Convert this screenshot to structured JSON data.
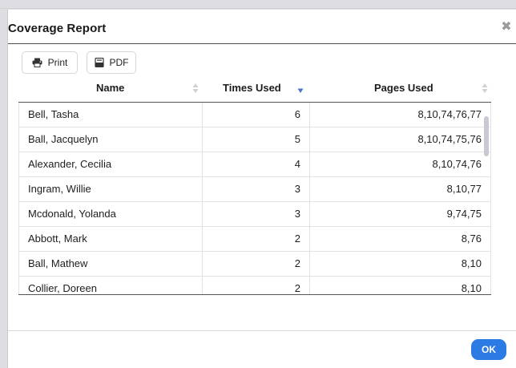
{
  "dialog": {
    "title": "Coverage Report",
    "close_label": "✖"
  },
  "toolbar": {
    "print_label": "Print",
    "pdf_label": "PDF"
  },
  "table": {
    "columns": [
      {
        "label": "Name",
        "sort": "none"
      },
      {
        "label": "Times Used",
        "sort": "descending"
      },
      {
        "label": "Pages Used",
        "sort": "none"
      }
    ],
    "rows": [
      {
        "name": "Bell, Tasha",
        "times": "6",
        "pages": "8,10,74,76,77"
      },
      {
        "name": "Ball, Jacquelyn",
        "times": "5",
        "pages": "8,10,74,75,76"
      },
      {
        "name": "Alexander, Cecilia",
        "times": "4",
        "pages": "8,10,74,76"
      },
      {
        "name": "Ingram, Willie",
        "times": "3",
        "pages": "8,10,77"
      },
      {
        "name": "Mcdonald, Yolanda",
        "times": "3",
        "pages": "9,74,75"
      },
      {
        "name": "Abbott, Mark",
        "times": "2",
        "pages": "8,76"
      },
      {
        "name": "Ball, Mathew",
        "times": "2",
        "pages": "8,10"
      },
      {
        "name": "Collier, Doreen",
        "times": "2",
        "pages": "8,10"
      }
    ]
  },
  "footer": {
    "ok_label": "OK"
  },
  "colors": {
    "accent": "#2c7be5",
    "sort_active": "#4a74c9",
    "sort_inactive": "#d0d0d6"
  },
  "icons": {
    "print": "printer-icon",
    "pdf": "pdf-file-icon",
    "close": "close-icon",
    "sort": "sort-arrows-icon"
  }
}
